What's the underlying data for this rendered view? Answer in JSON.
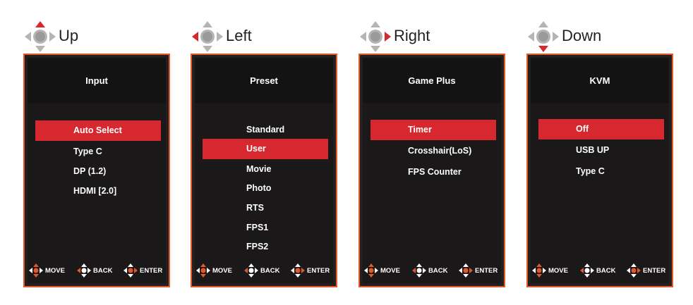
{
  "colors": {
    "accent": "#d7282f",
    "border": "#e2582b",
    "panel_bg": "#141313"
  },
  "columns": [
    {
      "direction": "Up",
      "title": "Input",
      "items": [
        "Auto Select",
        "Type C",
        "DP (1.2)",
        "HDMI [2.0]"
      ],
      "selected_index": 0,
      "highlighted_arrow": "up"
    },
    {
      "direction": "Left",
      "title": "Preset",
      "items": [
        "Standard",
        "User",
        "Movie",
        "Photo",
        "RTS",
        "FPS1",
        "FPS2"
      ],
      "selected_index": 1,
      "highlighted_arrow": "left"
    },
    {
      "direction": "Right",
      "title": "Game Plus",
      "items": [
        "Timer",
        "Crosshair(LoS)",
        "FPS Counter"
      ],
      "selected_index": 0,
      "highlighted_arrow": "right"
    },
    {
      "direction": "Down",
      "title": "KVM",
      "items": [
        "Off",
        "USB UP",
        "Type C"
      ],
      "selected_index": 0,
      "highlighted_arrow": "down"
    }
  ],
  "footer": {
    "move_label": "MOVE",
    "back_label": "BACK",
    "enter_label": "ENTER"
  }
}
